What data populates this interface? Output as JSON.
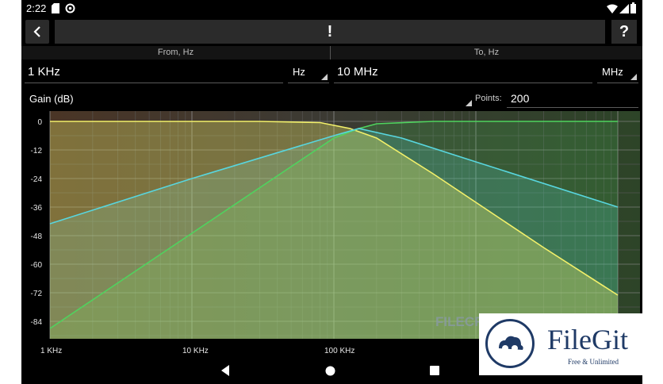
{
  "status_bar": {
    "time": "2:22"
  },
  "toolbar": {
    "back_icon": "chevron-left-icon",
    "title": "!",
    "help_label": "?"
  },
  "range": {
    "from_header": "From, Hz",
    "to_header": "To, Hz",
    "from_value": "1 KHz",
    "from_unit": "Hz",
    "to_value": "10 MHz",
    "to_unit": "MHz"
  },
  "gain": {
    "label": "Gain (dB)",
    "points_label": "Points:",
    "points_value": "200"
  },
  "chart_data": {
    "type": "line",
    "xscale": "log",
    "xlim": [
      1000,
      10000000
    ],
    "ylim": [
      -92,
      2
    ],
    "x_ticks": [
      {
        "value": 1000,
        "label": "1 KHz"
      },
      {
        "value": 10000,
        "label": "10 KHz"
      },
      {
        "value": 100000,
        "label": "100 KHz"
      }
    ],
    "y_ticks": [
      0,
      -12,
      -24,
      -36,
      -48,
      -60,
      -72,
      -84
    ],
    "grid": true,
    "colors": {
      "lowpass": "#f2f06a",
      "highpass": "#4fd35e",
      "bandpass": "#58d6de"
    },
    "series": [
      {
        "key": "lowpass",
        "x": [
          1000,
          30000,
          80000,
          130000,
          200000,
          500000,
          1000000,
          3000000,
          10000000
        ],
        "y": [
          0,
          0,
          -0.5,
          -3,
          -7,
          -22,
          -34,
          -53,
          -73
        ]
      },
      {
        "key": "highpass",
        "x": [
          1000,
          10000,
          50000,
          100000,
          150000,
          200000,
          500000,
          1000000,
          10000000
        ],
        "y": [
          -87,
          -47,
          -19,
          -7,
          -3,
          -1,
          0,
          0,
          0
        ]
      },
      {
        "key": "bandpass",
        "x": [
          1000,
          10000,
          100000,
          150000,
          300000,
          1000000,
          10000000
        ],
        "y": [
          -43,
          -24,
          -6,
          -3,
          -7,
          -17,
          -36
        ]
      }
    ]
  },
  "watermarks": {
    "center": "FILECR",
    "brand": "FileGit",
    "tagline": "Free & Unlimited"
  }
}
